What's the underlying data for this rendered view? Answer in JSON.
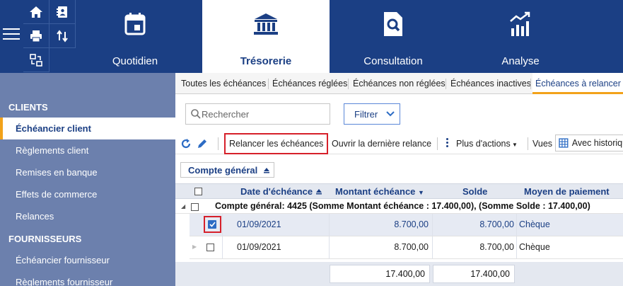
{
  "modules": [
    {
      "label": "Quotidien",
      "icon": "calendar-icon"
    },
    {
      "label": "Trésorerie",
      "icon": "bank-icon",
      "active": true
    },
    {
      "label": "Consultation",
      "icon": "document-search-icon"
    },
    {
      "label": "Analyse",
      "icon": "bar-chart-icon"
    }
  ],
  "quick_actions": [
    "home-icon",
    "contacts-icon",
    "print-icon",
    "transfer-icon",
    "sort-arrows-icon",
    "menu-icon"
  ],
  "sidebar": {
    "sections": [
      {
        "title": "CLIENTS",
        "items": [
          "Échéancier client",
          "Règlements client",
          "Remises en banque",
          "Effets de commerce",
          "Relances"
        ]
      },
      {
        "title": "FOURNISSEURS",
        "items": [
          "Échéancier fournisseur",
          "Règlements fournisseur"
        ]
      }
    ],
    "active_item": "Échéancier client"
  },
  "tabs": [
    "Toutes les échéances",
    "Échéances réglées",
    "Échéances non réglées",
    "Échéances inactives",
    "Échéances à relancer"
  ],
  "active_tab": "Échéances à relancer",
  "search": {
    "placeholder": "Rechercher"
  },
  "filter": {
    "label": "Filtrer"
  },
  "toolbar": {
    "relancer": "Relancer les échéances",
    "ouvrir": "Ouvrir la dernière relance",
    "plus": "Plus d'actions",
    "vues": "Vues",
    "vues_value": "Avec historique"
  },
  "group_chip": {
    "label": "Compte général"
  },
  "grid": {
    "columns": [
      "Date d'échéance",
      "Montant échéance",
      "Solde",
      "Moyen de paiement"
    ],
    "group_label": "Compte général: 4425 (Somme Montant échéance : 17.400,00), (Somme Solde : 17.400,00)",
    "rows": [
      {
        "date": "01/09/2021",
        "montant": "8.700,00",
        "solde": "8.700,00",
        "moyen": "Chèque",
        "checked": true
      },
      {
        "date": "01/09/2021",
        "montant": "8.700,00",
        "solde": "8.700,00",
        "moyen": "Chèque",
        "checked": false
      }
    ],
    "totals": {
      "montant": "17.400,00",
      "solde": "17.400,00"
    }
  },
  "colors": {
    "navy": "#1b3f84",
    "sidebar": "#6c80ad",
    "accent": "#f2a21a",
    "highlight": "#d6202a"
  }
}
